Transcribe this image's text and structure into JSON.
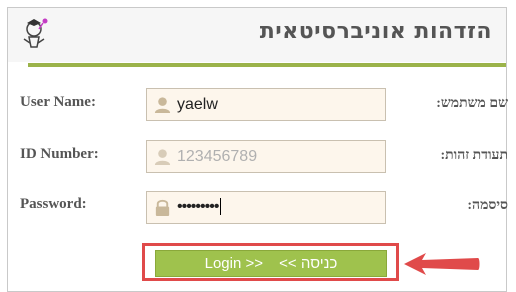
{
  "header": {
    "title": "הזדהות אוניברסיטאית",
    "logo_icon": "university-logo-icon"
  },
  "form": {
    "username": {
      "label_en": "User Name:",
      "label_he": "שם משתמש:",
      "value": "yaelw",
      "icon": "user-icon"
    },
    "id_number": {
      "label_en": "ID Number:",
      "label_he": "תעודת זהות:",
      "placeholder": "123456789",
      "icon": "user-icon"
    },
    "password": {
      "label_en": "Password:",
      "label_he": "סיסמה:",
      "masked_value": "•••••••••",
      "icon": "lock-icon"
    }
  },
  "login_button": {
    "label_en": "Login >>",
    "label_he": "כניסה >>"
  },
  "colors": {
    "accent_green": "#9fc24d",
    "highlight_red": "#e04a4a",
    "field_bg": "#fdf6ec",
    "label_gray": "#555555"
  }
}
